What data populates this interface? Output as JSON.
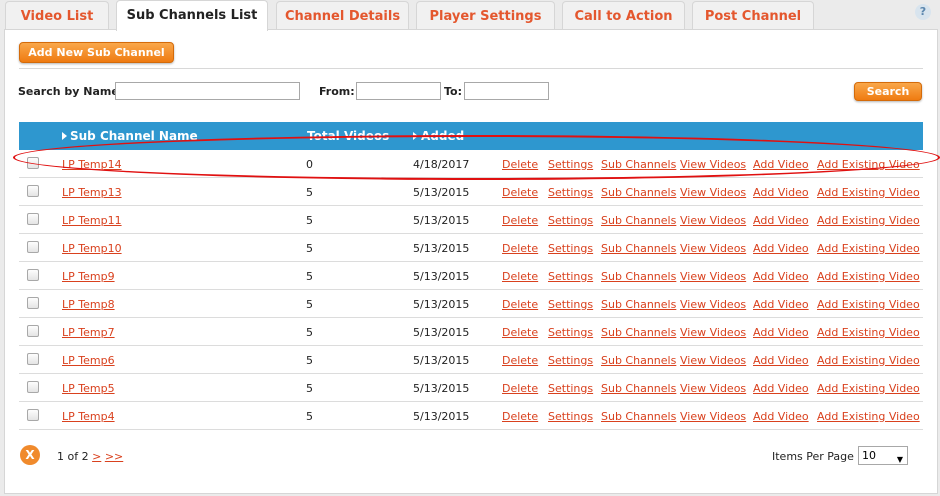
{
  "tabs": [
    {
      "label": "Video List"
    },
    {
      "label": "Sub Channels List"
    },
    {
      "label": "Channel Details"
    },
    {
      "label": "Player Settings"
    },
    {
      "label": "Call to Action"
    },
    {
      "label": "Post Channel"
    }
  ],
  "help_icon": "?",
  "toolbar": {
    "add_label": "Add New Sub Channel"
  },
  "search": {
    "name_label": "Search by Name:",
    "name_value": "",
    "from_label": "From:",
    "from_value": "",
    "to_label": "To:",
    "to_value": "",
    "button_label": "Search"
  },
  "table": {
    "headers": {
      "name": "Sub Channel Name",
      "total": "Total Videos",
      "added": "Added"
    },
    "actions": [
      "Delete",
      "Settings",
      "Sub Channels",
      "View Videos",
      "Add Video",
      "Add Existing Video"
    ],
    "rows": [
      {
        "name": "LP Temp14",
        "total": "0",
        "added": "4/18/2017"
      },
      {
        "name": "LP Temp13",
        "total": "5",
        "added": "5/13/2015"
      },
      {
        "name": "LP Temp11",
        "total": "5",
        "added": "5/13/2015"
      },
      {
        "name": "LP Temp10",
        "total": "5",
        "added": "5/13/2015"
      },
      {
        "name": "LP Temp9",
        "total": "5",
        "added": "5/13/2015"
      },
      {
        "name": "LP Temp8",
        "total": "5",
        "added": "5/13/2015"
      },
      {
        "name": "LP Temp7",
        "total": "5",
        "added": "5/13/2015"
      },
      {
        "name": "LP Temp6",
        "total": "5",
        "added": "5/13/2015"
      },
      {
        "name": "LP Temp5",
        "total": "5",
        "added": "5/13/2015"
      },
      {
        "name": "LP Temp4",
        "total": "5",
        "added": "5/13/2015"
      }
    ]
  },
  "pager": {
    "close_icon": "X",
    "page_text": "1 of 2",
    "next": ">",
    "last": ">>",
    "items_per_page_label": "Items Per Page",
    "items_per_page_value": "10"
  },
  "colors": {
    "accent": "#ef7b11",
    "header": "#2e97cf",
    "link": "#d9411e",
    "highlight": "#e01010"
  }
}
